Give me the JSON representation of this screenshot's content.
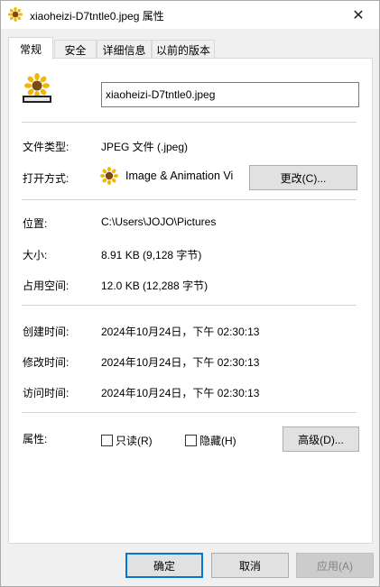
{
  "window": {
    "title": "xiaoheizi-D7tntle0.jpeg 属性",
    "close_glyph": "✕"
  },
  "tabs": [
    {
      "label": "常规",
      "active": true
    },
    {
      "label": "安全",
      "active": false
    },
    {
      "label": "详细信息",
      "active": false
    },
    {
      "label": "以前的版本",
      "active": false
    }
  ],
  "general": {
    "file_name": "xiaoheizi-D7tntle0.jpeg",
    "file_type_label": "文件类型:",
    "file_type_value": "JPEG 文件 (.jpeg)",
    "open_with_label": "打开方式:",
    "open_with_app": "Image & Animation Vi",
    "change_button": "更改(C)...",
    "location_label": "位置:",
    "location_value": "C:\\Users\\JOJO\\Pictures",
    "size_label": "大小:",
    "size_value": "8.91 KB (9,128 字节)",
    "size_on_disk_label": "占用空间:",
    "size_on_disk_value": "12.0 KB (12,288 字节)",
    "created_label": "创建时间:",
    "created_value": "2024年10月24日，下午 02:30:13",
    "modified_label": "修改时间:",
    "modified_value": "2024年10月24日，下午 02:30:13",
    "accessed_label": "访问时间:",
    "accessed_value": "2024年10月24日，下午 02:30:13",
    "attributes_label": "属性:",
    "readonly_label": "只读(R)",
    "readonly_checked": false,
    "hidden_label": "隐藏(H)",
    "hidden_checked": false,
    "advanced_button": "高级(D)..."
  },
  "footer": {
    "ok": "确定",
    "cancel": "取消",
    "apply": "应用(A)"
  },
  "icons": {
    "file_icon": "imagine-sunflower-icon",
    "app_icon": "sunflower-icon"
  },
  "colors": {
    "accent": "#0078d7",
    "panel": "#ffffff",
    "background": "#f0f0f0"
  }
}
